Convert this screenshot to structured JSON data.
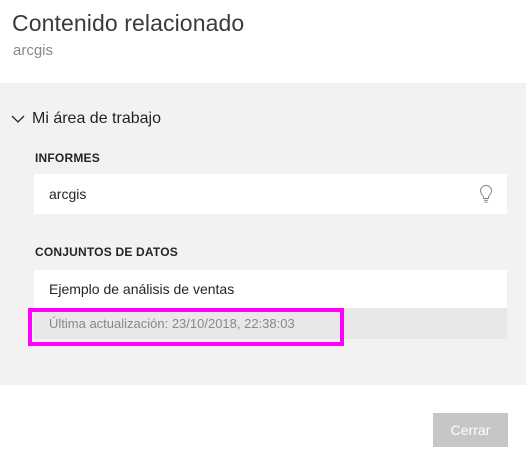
{
  "dialog": {
    "title": "Contenido relacionado",
    "subtitle": "arcgis"
  },
  "workspace": {
    "label": "Mi área de trabajo",
    "expanded_icon": "chevron-down-icon"
  },
  "reports": {
    "section_label": "INFORMES",
    "items": [
      {
        "name": "arcgis",
        "icon": "lightbulb-icon"
      }
    ]
  },
  "datasets": {
    "section_label": "CONJUNTOS DE DATOS",
    "items": [
      {
        "name": "Ejemplo de análisis de ventas",
        "last_updated": "Última actualización: 23/10/2018, 22:38:03"
      }
    ]
  },
  "footer": {
    "close_label": "Cerrar"
  },
  "colors": {
    "panel_bg": "#f3f2f1",
    "highlight": "#ff00ff",
    "button_bg": "#c8c6c4"
  }
}
